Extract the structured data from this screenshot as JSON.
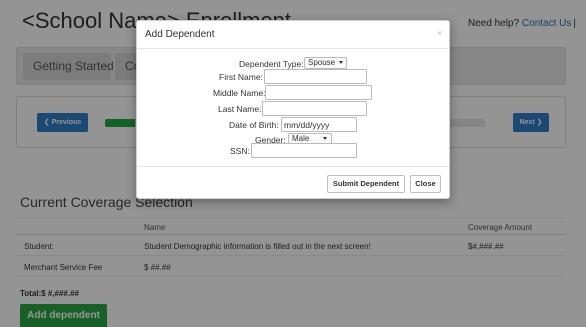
{
  "page": {
    "title": "<School Name> Enrollment",
    "help_text": "Need help?",
    "help_link": "Contact Us",
    "help_separator": "|"
  },
  "nav": {
    "items": [
      {
        "label": "Getting Started"
      },
      {
        "label": "Co"
      }
    ]
  },
  "progress": {
    "prev_label": "Previous",
    "next_label": "Next",
    "value_percent": 8
  },
  "coverage": {
    "title": "Current Coverage Selection",
    "columns": [
      "Name",
      "Coverage Amount"
    ],
    "rows": [
      {
        "label": "Student:",
        "name": "Student Demographic information is filled out in the next screen!",
        "amount": "$#,###.##"
      },
      {
        "label": "Merchant Service Fee",
        "name": "$ ##.##",
        "amount": ""
      }
    ],
    "total": "Total:$ #,###.##",
    "add_button": "Add dependent"
  },
  "modal": {
    "title": "Add Dependent",
    "close_symbol": "×",
    "fields": {
      "dependent_type": {
        "label": "Dependent Type:",
        "value": "Spouse"
      },
      "first_name": {
        "label": "First Name:",
        "value": ""
      },
      "middle_name": {
        "label": "Middle Name:",
        "value": ""
      },
      "last_name": {
        "label": "Last Name:",
        "value": ""
      },
      "dob": {
        "label": "Date of Birth:",
        "placeholder": "mm/dd/yyyy"
      },
      "gender": {
        "label": "Gender:",
        "value": "Male"
      },
      "ssn": {
        "label": "SSN:",
        "value": ""
      }
    },
    "submit_label": "Submit Dependent",
    "close_label": "Close"
  }
}
